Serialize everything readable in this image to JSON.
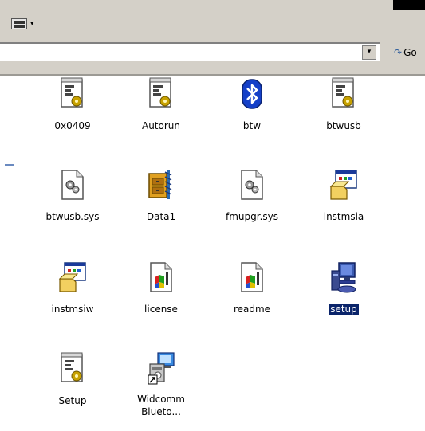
{
  "toolbar": {
    "views_caret": "▾"
  },
  "addressbar": {
    "dropdown_arrow": "▾",
    "go_label": "Go"
  },
  "files": [
    {
      "name": "0x0409",
      "icon": "config-settings-icon"
    },
    {
      "name": "Autorun",
      "icon": "config-settings-icon"
    },
    {
      "name": "btw",
      "icon": "bluetooth-icon"
    },
    {
      "name": "btwusb",
      "icon": "config-settings-icon"
    },
    {
      "name": "btwusb.sys",
      "icon": "system-file-icon"
    },
    {
      "name": "Data1",
      "icon": "cabinet-archive-icon"
    },
    {
      "name": "fmupgr.sys",
      "icon": "system-file-icon"
    },
    {
      "name": "instmsia",
      "icon": "installer-icon"
    },
    {
      "name": "instmsiw",
      "icon": "installer-icon"
    },
    {
      "name": "license",
      "icon": "rich-text-document-icon"
    },
    {
      "name": "readme",
      "icon": "rich-text-document-icon"
    },
    {
      "name": "setup",
      "icon": "setup-computer-icon",
      "selected": true
    },
    {
      "name": "Setup",
      "icon": "config-settings-icon"
    },
    {
      "name": "Widcomm Blueto...",
      "line1": "Widcomm",
      "line2": "Blueto...",
      "icon": "shortcut-setup-icon"
    }
  ]
}
